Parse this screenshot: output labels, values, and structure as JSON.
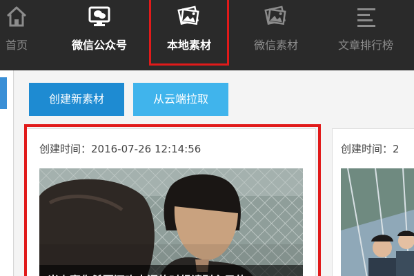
{
  "nav": {
    "items": [
      {
        "label": "首页",
        "icon": "home-icon"
      },
      {
        "label": "微信公众号",
        "icon": "wechat-monitor-icon"
      },
      {
        "label": "本地素材",
        "icon": "local-images-icon"
      },
      {
        "label": "微信素材",
        "icon": "wechat-images-icon"
      },
      {
        "label": "文章排行榜",
        "icon": "ranking-list-icon"
      }
    ],
    "active": "本地素材"
  },
  "toolbar": {
    "create_label": "创建新素材",
    "pull_label": "从云端拉取"
  },
  "cards": [
    {
      "time": "创建时间：2016-07-26 12:14:56",
      "caption": "当上案你希要还吃古调的时候请别主子的"
    },
    {
      "time": "创建时间：2"
    }
  ],
  "colors": {
    "nav_bg": "#2a2a2a",
    "active_outline": "#e11a1a",
    "create_button": "#1e8bd2",
    "pull_button": "#40b4ec"
  }
}
